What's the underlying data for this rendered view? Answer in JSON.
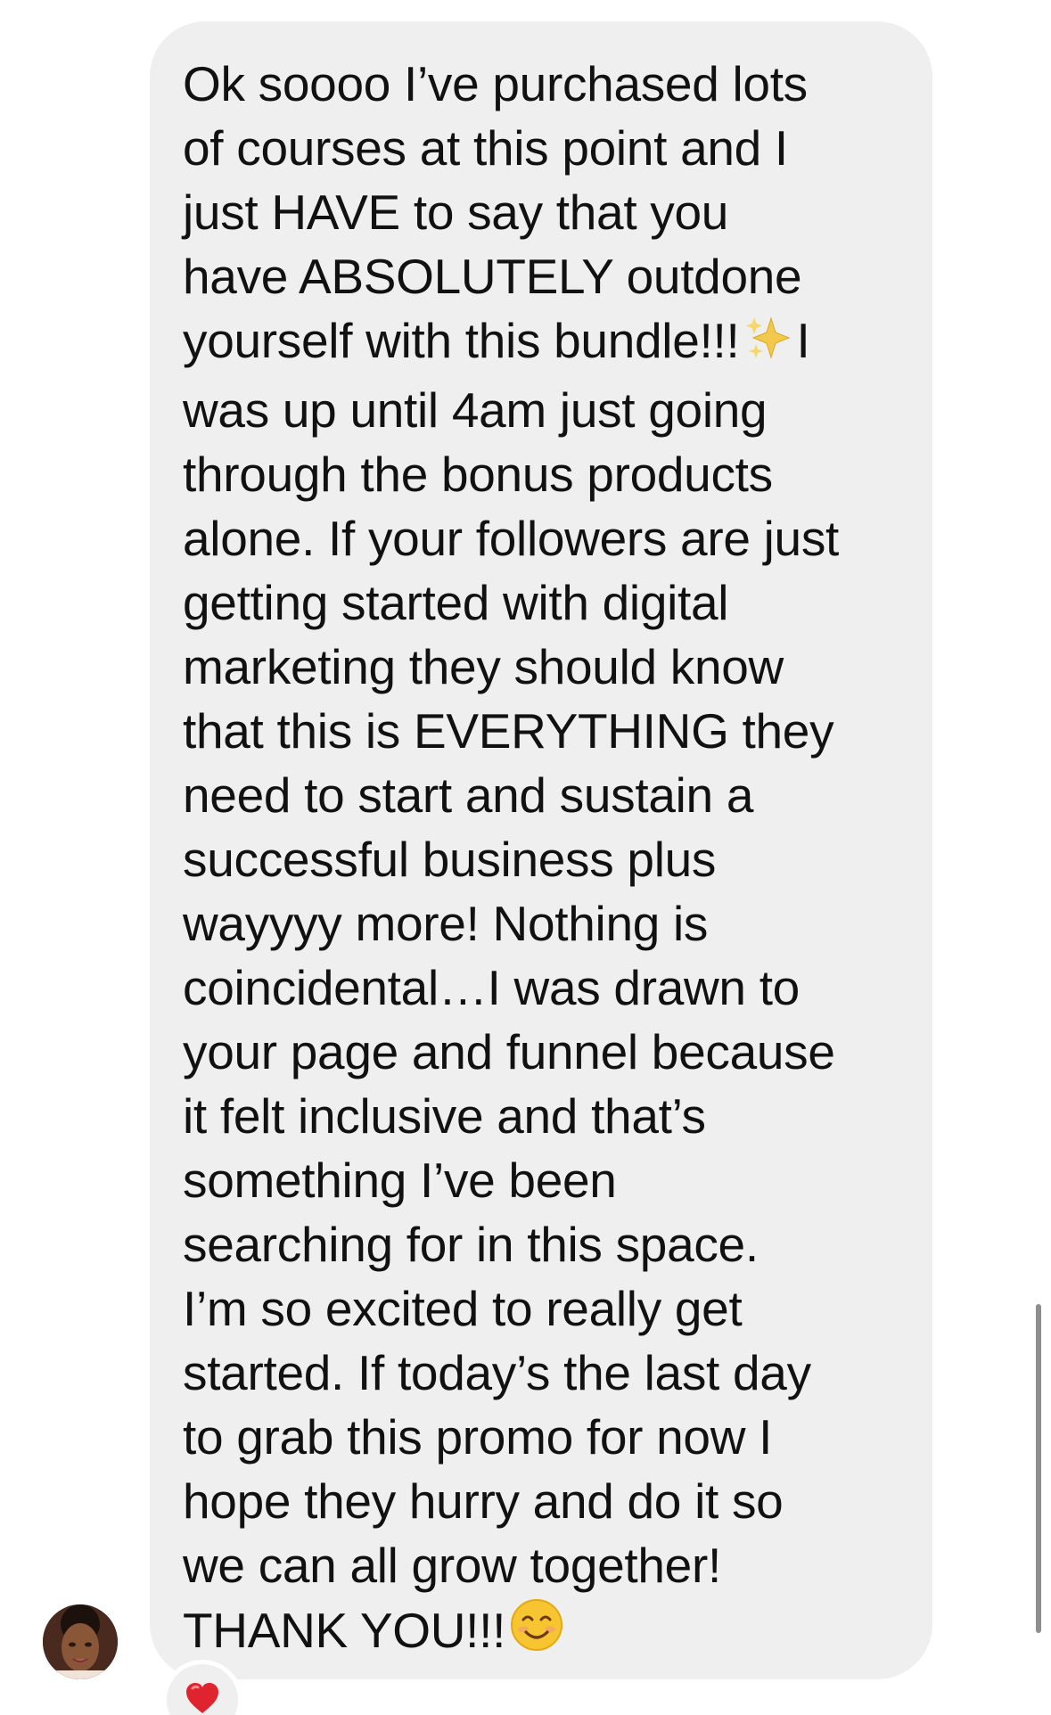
{
  "message": {
    "lines": [
      "Ok soooo I’ve purchased lots",
      "of courses at this point and I",
      "just HAVE to say that you",
      "have ABSOLUTELY outdone",
      "yourself with this bundle!!!",
      "was up until 4am just going",
      "through the bonus products",
      "alone. If your followers are just",
      "getting started with digital",
      "marketing they should know",
      "that this is EVERYTHING they",
      "need to start and sustain a",
      "successful business plus",
      "wayyyy more! Nothing is",
      "coincidental…I was drawn to",
      "your page and funnel because",
      "it felt inclusive and that’s",
      "something I’ve been",
      "searching for in this space.",
      "I’m so excited to really get",
      "started. If today’s the last day",
      "to grab this promo for now I",
      "hope they hurry and do it so",
      "we can all grow together!",
      "THANK YOU!!!"
    ],
    "line5_after_sparkles": "I",
    "emoji_inline": "sparkles-icon",
    "emoji_end": "smiling-face-icon"
  },
  "reaction": {
    "icon": "heart-icon",
    "color": "#e0242f"
  },
  "colors": {
    "bubble": "#efefef",
    "text": "#111111",
    "background": "#ffffff"
  }
}
